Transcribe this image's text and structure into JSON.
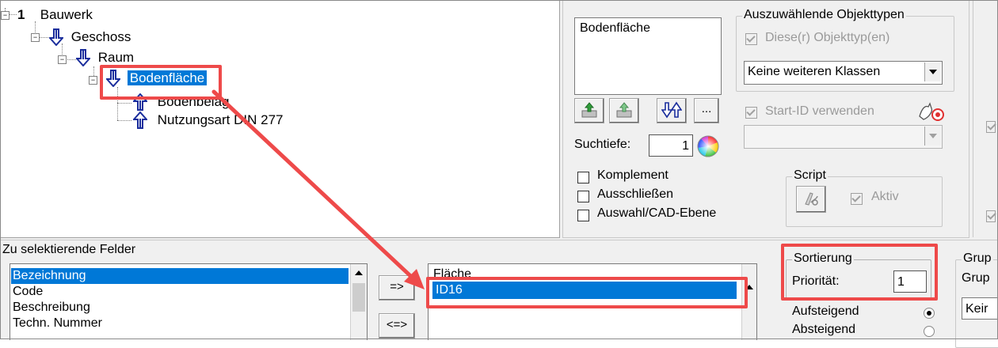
{
  "tree": {
    "nodes": [
      {
        "label": "Bauwerk",
        "icon": "number-one-circle-icon",
        "badge": "1"
      },
      {
        "label": "Geschoss",
        "icon": "blue-down-arrow-icon"
      },
      {
        "label": "Raum",
        "icon": "blue-down-arrow-icon"
      },
      {
        "label": "Bodenfläche",
        "icon": "blue-down-arrow-icon",
        "selected": true
      },
      {
        "label": "Bodenbelag",
        "icon": "blue-up-arrow-icon"
      },
      {
        "label": "Nutzungsart DIN 277",
        "icon": "blue-up-arrow-icon"
      }
    ]
  },
  "classes_list": {
    "items": [
      "Bodenfläche"
    ]
  },
  "object_types": {
    "label": "Auszuwählende Objekttypen",
    "checkbox_label": "Diese(r) Objekttyp(en)",
    "combo_value": "Keine weiteren Klassen",
    "start_id_label": "Start-ID verwenden"
  },
  "search": {
    "depth_label": "Suchtiefe:",
    "depth_value": "1",
    "more_button": "..."
  },
  "options": {
    "complement": "Komplement",
    "exclude": "Ausschließen",
    "cad_layer": "Auswahl/CAD-Ebene"
  },
  "script": {
    "label": "Script",
    "active_label": "Aktiv"
  },
  "fields": {
    "label": "Zu selektierende Felder",
    "available": [
      "Bezeichnung",
      "Code",
      "Beschreibung",
      "Techn. Nummer"
    ],
    "move_right": "=>",
    "move_both": "<=>",
    "selected": [
      "Fläche",
      "ID16"
    ]
  },
  "sorting": {
    "label": "Sortierung",
    "priority_label": "Priorität:",
    "priority_value": "1",
    "ascending": "Aufsteigend",
    "descending": "Absteigend"
  },
  "grouping": {
    "label": "Grup",
    "sub_label": "Grup",
    "combo_value": "Keir"
  },
  "colors": {
    "selection": "#0078d7",
    "highlight": "#ee4a4a",
    "arrow_blue": "#1a2d9c"
  }
}
